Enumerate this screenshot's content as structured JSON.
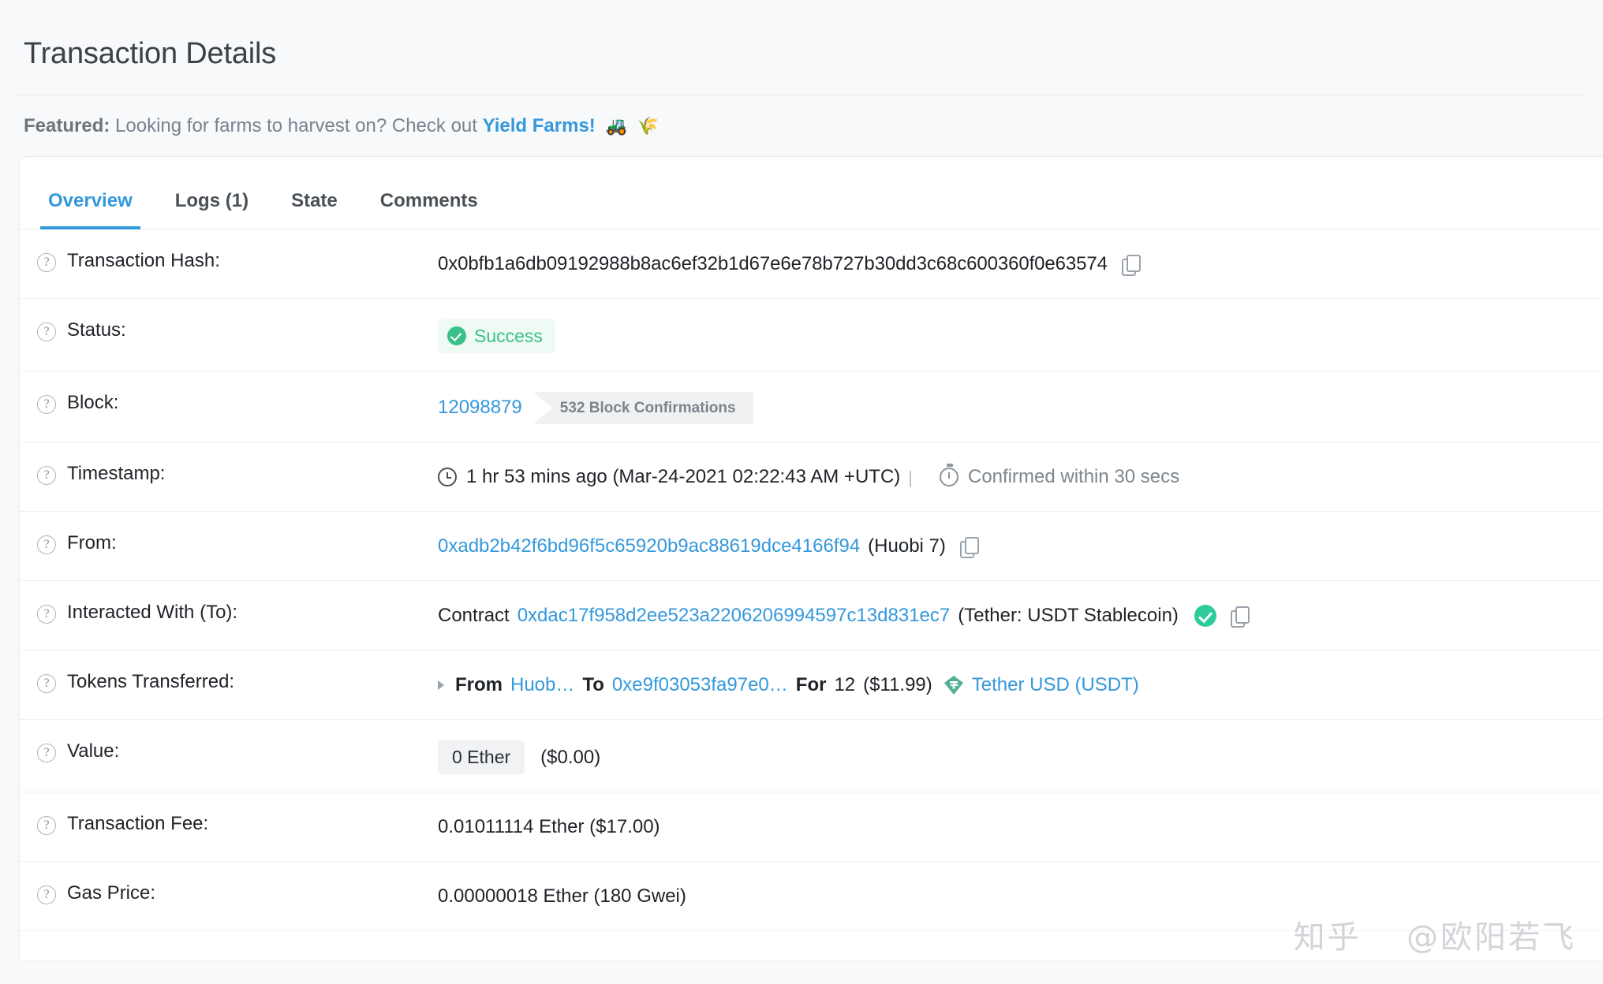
{
  "header": {
    "title": "Transaction Details"
  },
  "featured": {
    "label": "Featured:",
    "text": "Looking for farms to harvest on? Check out",
    "link_label": "Yield Farms!",
    "emoji_tractor": "🚜",
    "emoji_rice": "🌾"
  },
  "tabs": [
    {
      "label": "Overview",
      "active": true
    },
    {
      "label": "Logs (1)",
      "active": false
    },
    {
      "label": "State",
      "active": false
    },
    {
      "label": "Comments",
      "active": false
    }
  ],
  "details": {
    "transaction_hash": {
      "label": "Transaction Hash:",
      "value": "0x0bfb1a6db09192988b8ac6ef32b1d67e6e78b727b30dd3c68c600360f0e63574"
    },
    "status": {
      "label": "Status:",
      "badge": "Success"
    },
    "block": {
      "label": "Block:",
      "number": "12098879",
      "confirmations": "532 Block Confirmations"
    },
    "timestamp": {
      "label": "Timestamp:",
      "ago": "1 hr 53 mins ago (Mar-24-2021 02:22:43 AM +UTC)",
      "separator": "|",
      "confirmed": "Confirmed within 30 secs"
    },
    "from": {
      "label": "From:",
      "address": "0xadb2b42f6bd96f5c65920b9ac88619dce4166f94",
      "tag": "(Huobi 7)"
    },
    "interacted_with": {
      "label": "Interacted With (To):",
      "prefix": "Contract",
      "address": "0xdac17f958d2ee523a2206206994597c13d831ec7",
      "tag": "(Tether: USDT Stablecoin)"
    },
    "tokens_transferred": {
      "label": "Tokens Transferred:",
      "from_word": "From",
      "from_value": "Huob…",
      "to_word": "To",
      "to_value": "0xe9f03053fa97e0…",
      "for_word": "For",
      "amount": "12",
      "usd": "($11.99)",
      "token_name": "Tether USD (USDT)"
    },
    "value": {
      "label": "Value:",
      "amount": "0 Ether",
      "usd": "($0.00)"
    },
    "transaction_fee": {
      "label": "Transaction Fee:",
      "value": "0.01011114 Ether ($17.00)"
    },
    "gas_price": {
      "label": "Gas Price:",
      "value": "0.00000018 Ether (180 Gwei)"
    }
  },
  "icons": {
    "help": "?",
    "copy": "copy-icon"
  },
  "watermark": {
    "site": "知乎",
    "user": "@欧阳若飞"
  },
  "colors": {
    "accent_blue": "#3498db",
    "success_green": "#3ac18a",
    "page_bg": "#f8f9fa",
    "card_bg": "#ffffff",
    "border": "#e9ecef",
    "text": "#1f2328",
    "muted": "#6c757d"
  }
}
